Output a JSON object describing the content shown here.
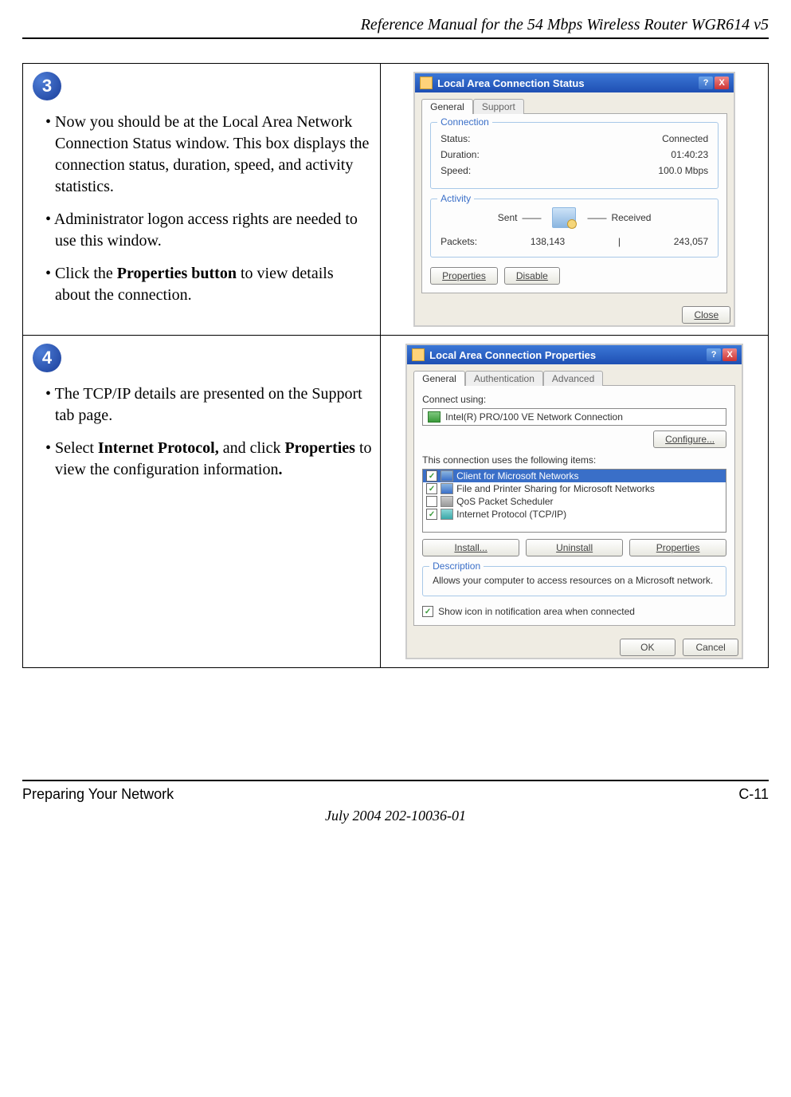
{
  "header": "Reference Manual for the 54 Mbps Wireless Router WGR614 v5",
  "step3": {
    "num": "3",
    "bullet1_a": "Now you should be at the Local Area Network Connection Status window. This box displays the connection status, duration, speed, and activity statistics.",
    "bullet2": "Administrator logon access rights are needed to use this window.",
    "bullet3_a": "Click the ",
    "bullet3_b": "Properties button",
    "bullet3_c": " to view details about the connection."
  },
  "win1": {
    "title": "Local Area Connection Status",
    "tab_general": "General",
    "tab_support": "Support",
    "grp_conn": "Connection",
    "status_lbl": "Status:",
    "status_val": "Connected",
    "duration_lbl": "Duration:",
    "duration_val": "01:40:23",
    "speed_lbl": "Speed:",
    "speed_val": "100.0 Mbps",
    "grp_act": "Activity",
    "sent": "Sent",
    "received": "Received",
    "packets_lbl": "Packets:",
    "packets_sent": "138,143",
    "packets_recv": "243,057",
    "btn_props": "Properties",
    "btn_disable": "Disable",
    "btn_close": "Close"
  },
  "step4": {
    "num": "4",
    "bullet1": "The TCP/IP details are presented on the Support tab page.",
    "bullet2_a": "Select ",
    "bullet2_b": "Internet Protocol,",
    "bullet2_c": " and click ",
    "bullet2_d": "Properties",
    "bullet2_e": " to view the configuration information",
    "bullet2_f": "."
  },
  "win2": {
    "title": "Local Area Connection Properties",
    "tab_general": "General",
    "tab_auth": "Authentication",
    "tab_adv": "Advanced",
    "connect_using": "Connect using:",
    "nic": "Intel(R) PRO/100 VE Network Connection",
    "btn_configure": "Configure...",
    "uses_items": "This connection uses the following items:",
    "item1": "Client for Microsoft Networks",
    "item2": "File and Printer Sharing for Microsoft Networks",
    "item3": "QoS Packet Scheduler",
    "item4": "Internet Protocol (TCP/IP)",
    "btn_install": "Install...",
    "btn_uninstall": "Uninstall",
    "btn_properties": "Properties",
    "grp_desc": "Description",
    "desc_text": "Allows your computer to access resources on a Microsoft network.",
    "show_icon": "Show icon in notification area when connected",
    "btn_ok": "OK",
    "btn_cancel": "Cancel"
  },
  "footer": {
    "left": "Preparing Your Network",
    "right": "C-11",
    "date": "July 2004 202-10036-01"
  }
}
